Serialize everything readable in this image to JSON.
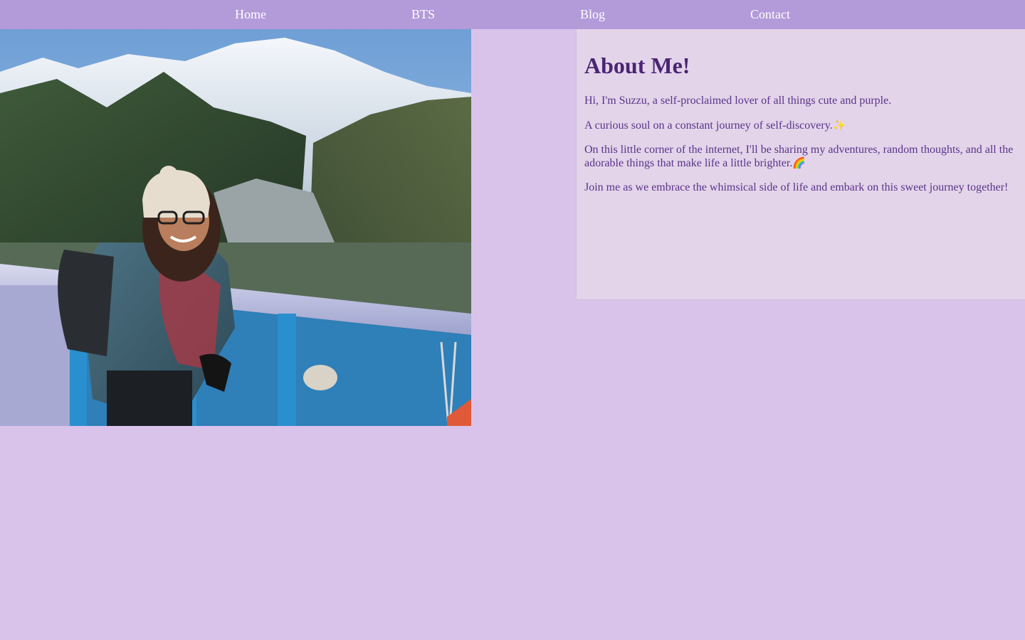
{
  "nav": {
    "items": [
      {
        "label": "Home"
      },
      {
        "label": "BTS"
      },
      {
        "label": "Blog"
      },
      {
        "label": "Contact"
      }
    ]
  },
  "about": {
    "title": "About Me!",
    "paragraphs": [
      {
        "text": "Hi, I'm Suzzu, a self-proclaimed lover of all things cute and purple.",
        "emoji": ""
      },
      {
        "text": "A curious soul on a constant journey of self-discovery.",
        "emoji": "✨"
      },
      {
        "text": "On this little corner of the internet, I'll be sharing my adventures, random thoughts, and all the adorable things that make life a little brighter.",
        "emoji": "🌈"
      },
      {
        "text": "Join me as we embrace the whimsical side of life and embark on this sweet journey together!",
        "emoji": ""
      }
    ]
  },
  "photo": {
    "subject": "woman-in-beanie-mountain-viewpoint"
  },
  "colors": {
    "nav_bg": "#b39ad9",
    "page_bg": "#d9c3eb",
    "card_bg": "#e3d4ea",
    "heading": "#4a2572",
    "text": "#5a3488"
  }
}
